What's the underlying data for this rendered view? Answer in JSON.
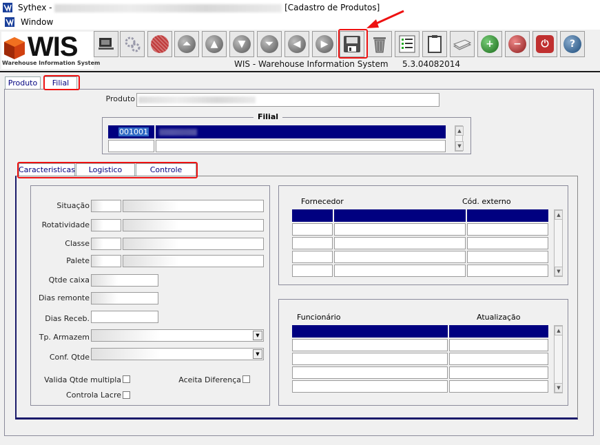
{
  "window": {
    "app_name": "Sythex -",
    "title_suffix": "[Cadastro de Produtos]",
    "menu_window": "Window"
  },
  "header": {
    "app_full_name": "WIS - Warehouse Information System",
    "version": "5.3.04082014",
    "logo_text": "WIS",
    "logo_subtitle": "Warehouse Information System"
  },
  "tabs_top": {
    "produto": "Produto",
    "filial": "Filial"
  },
  "filial_section": {
    "produto_label": "Produto",
    "filial_title": "Filial",
    "rows": [
      {
        "code": "001001",
        "name": ""
      },
      {
        "code": "",
        "name": ""
      }
    ]
  },
  "tabs_inner": {
    "caracteristicas": "Caracteristicas",
    "logistico": "Logistico",
    "controle": "Controle"
  },
  "form": {
    "situacao": "Situação",
    "rotatividade": "Rotatividade",
    "classe": "Classe",
    "palete": "Palete",
    "qtde_caixa": "Qtde caixa",
    "dias_remonte": "Dias remonte",
    "dias_receb": "Dias Receb.",
    "tp_armazem": "Tp. Armazem",
    "conf_qtde": "Conf. Qtde",
    "valida_qtde_multipla": "Valida Qtde multipla",
    "aceita_diferenca": "Aceita Diferença",
    "controla_lacre": "Controla Lacre"
  },
  "fornecedor_grid": {
    "col1": "Fornecedor",
    "col2": "Cód. externo"
  },
  "funcionario_grid": {
    "col1": "Funcionário",
    "col2": "Atualização"
  },
  "colors": {
    "selection": "#000080",
    "annotation": "#e11111",
    "tab_text": "#000080"
  },
  "toolbar_icons": [
    "monitor-icon",
    "gears-icon",
    "stop-icon",
    "first-record-icon",
    "prev-record-icon",
    "next-record-icon",
    "last-record-icon",
    "left-arrow-icon",
    "right-arrow-icon",
    "save-icon",
    "trash-icon",
    "list-icon",
    "clipboard-icon",
    "papers-icon",
    "add-icon",
    "remove-icon",
    "power-icon",
    "help-icon"
  ]
}
